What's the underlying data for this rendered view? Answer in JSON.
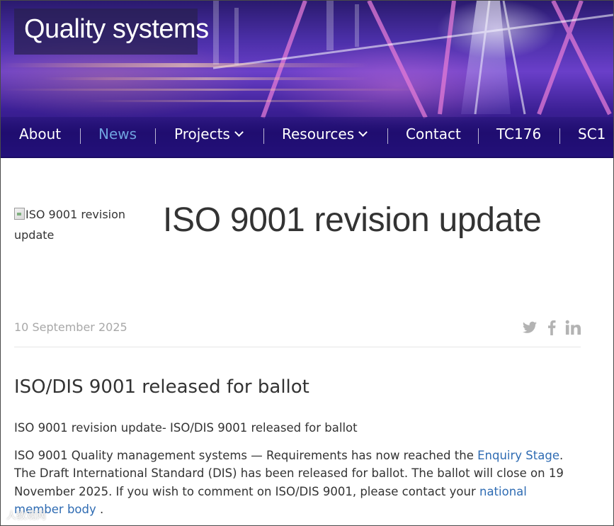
{
  "site": {
    "title": "Quality systems"
  },
  "nav": {
    "items": [
      {
        "label": "About",
        "active": false
      },
      {
        "label": "News",
        "active": true
      },
      {
        "label": "Projects",
        "has_dropdown": true
      },
      {
        "label": "Resources",
        "has_dropdown": true
      },
      {
        "label": "Contact"
      },
      {
        "label": "TC176"
      },
      {
        "label": "SC1"
      }
    ],
    "active_color": "#6fa3df"
  },
  "article": {
    "image_alt": "ISO 9001 revision update",
    "title": "ISO 9001 revision update",
    "date": "10 September 2025",
    "share_icons": [
      "twitter-icon",
      "facebook-icon",
      "linkedin-icon"
    ],
    "section_title": "ISO/DIS 9001 released for ballot",
    "para1": "ISO 9001 revision update- ISO/DIS 9001 released for ballot",
    "para2": {
      "text_a": "ISO 9001 Quality management systems — Requirements has now reached the ",
      "link_a": "Enquiry Stage",
      "text_b": ". The Draft International Standard (DIS)  has been released for ballot. The ballot will close on 19 November 2025. If you wish to comment on ISO/DIS 9001, please contact your ",
      "link_b": "national member body",
      "text_c": " ."
    },
    "link_color": "#2f6cb3"
  },
  "watermark": "人教观网"
}
